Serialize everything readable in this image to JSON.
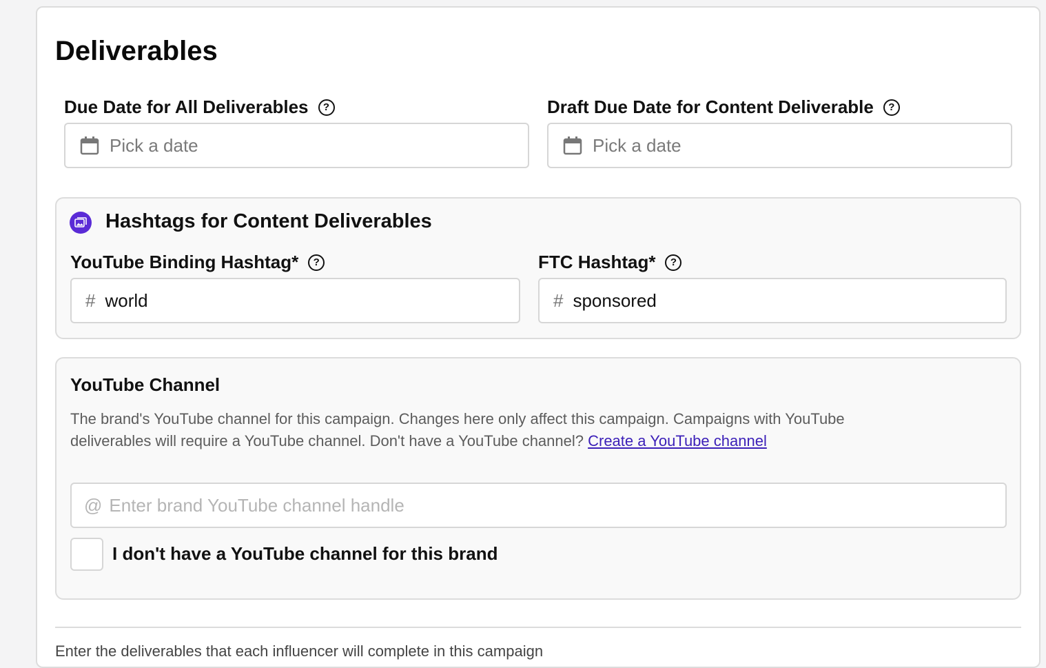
{
  "section_title": "Deliverables",
  "due_date": {
    "label": "Due Date for All Deliverables",
    "placeholder": "Pick a date"
  },
  "draft_due_date": {
    "label": "Draft Due Date for Content Deliverable",
    "placeholder": "Pick a date"
  },
  "hashtags": {
    "title": "Hashtags for Content Deliverables",
    "youtube_binding": {
      "label": "YouTube Binding Hashtag*",
      "prefix": "#",
      "value": "world"
    },
    "ftc": {
      "label": "FTC Hashtag*",
      "prefix": "#",
      "value": "sponsored"
    }
  },
  "youtube_channel": {
    "title": "YouTube Channel",
    "description": "The brand's YouTube channel for this campaign. Changes here only affect this campaign. Campaigns with YouTube deliverables will require a YouTube channel. Don't have a YouTube channel? ",
    "link_text": "Create a YouTube channel",
    "prefix": "@",
    "placeholder": "Enter brand YouTube channel handle",
    "checkbox_label": "I don't have a YouTube channel for this brand",
    "checkbox_checked": false
  },
  "help_glyph": "?",
  "bottom_text": "Enter the deliverables that each influencer will complete in this campaign",
  "colors": {
    "accent": "#5a2bd6",
    "link": "#3b1fb8",
    "border": "#d6d6d6"
  }
}
